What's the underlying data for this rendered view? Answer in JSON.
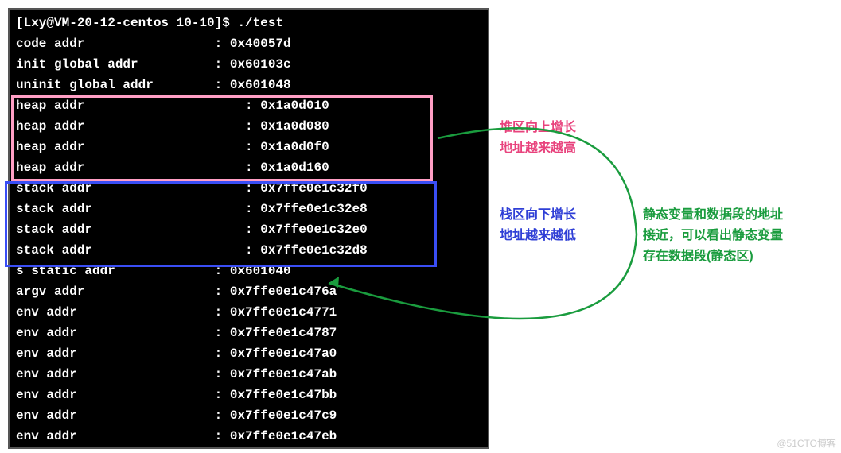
{
  "prompt": "[Lxy@VM-20-12-centos 10-10]$ ./test",
  "lines": [
    {
      "label": "code addr",
      "value": "0x40057d",
      "pad": 26
    },
    {
      "label": "init global addr",
      "value": "0x60103c",
      "pad": 26
    },
    {
      "label": "uninit global addr",
      "value": "0x601048",
      "pad": 26
    },
    {
      "label": "heap addr",
      "value": "0x1a0d010",
      "pad": 30
    },
    {
      "label": "heap addr",
      "value": "0x1a0d080",
      "pad": 30
    },
    {
      "label": "heap addr",
      "value": "0x1a0d0f0",
      "pad": 30
    },
    {
      "label": "heap addr",
      "value": "0x1a0d160",
      "pad": 30
    },
    {
      "label": "stack addr",
      "value": "0x7ffe0e1c32f0",
      "pad": 30
    },
    {
      "label": "stack addr",
      "value": "0x7ffe0e1c32e8",
      "pad": 30
    },
    {
      "label": "stack addr",
      "value": "0x7ffe0e1c32e0",
      "pad": 30
    },
    {
      "label": "stack addr",
      "value": "0x7ffe0e1c32d8",
      "pad": 30
    },
    {
      "label": "s static addr",
      "value": "0x601040",
      "pad": 26
    },
    {
      "label": "argv addr",
      "value": "0x7ffe0e1c476a",
      "pad": 26
    },
    {
      "label": "env addr",
      "value": "0x7ffe0e1c4771",
      "pad": 26
    },
    {
      "label": "env addr",
      "value": "0x7ffe0e1c4787",
      "pad": 26
    },
    {
      "label": "env addr",
      "value": "0x7ffe0e1c47a0",
      "pad": 26
    },
    {
      "label": "env addr",
      "value": "0x7ffe0e1c47ab",
      "pad": 26
    },
    {
      "label": "env addr",
      "value": "0x7ffe0e1c47bb",
      "pad": 26
    },
    {
      "label": "env addr",
      "value": "0x7ffe0e1c47c9",
      "pad": 26
    },
    {
      "label": "env addr",
      "value": "0x7ffe0e1c47eb",
      "pad": 26
    }
  ],
  "annotations": {
    "heap_line1": "堆区向上增长",
    "heap_line2": "地址越来越高",
    "stack_line1": "栈区向下增长",
    "stack_line2": "地址越来越低",
    "static_line1": "静态变量和数据段的地址",
    "static_line2": "接近，可以看出静态变量",
    "static_line3": "存在数据段(静态区)"
  },
  "watermark": "@51CTO博客"
}
